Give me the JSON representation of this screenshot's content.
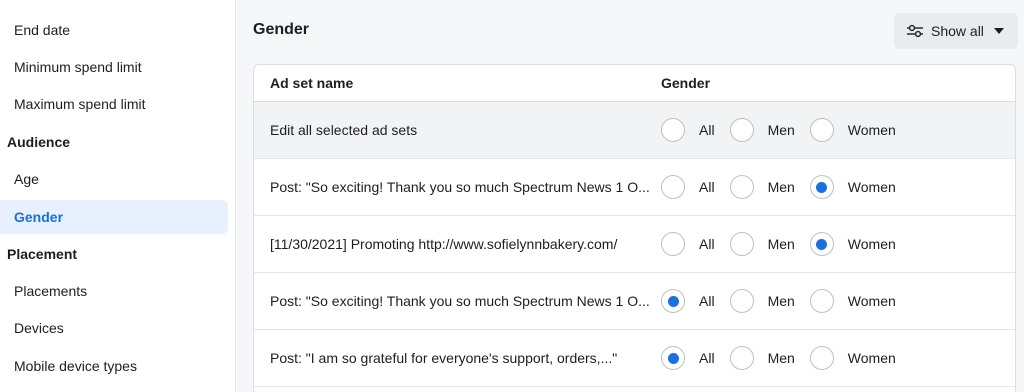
{
  "sidebar": {
    "items": [
      {
        "label": "End date",
        "type": "item"
      },
      {
        "label": "Minimum spend limit",
        "type": "item"
      },
      {
        "label": "Maximum spend limit",
        "type": "item"
      },
      {
        "label": "Audience",
        "type": "section"
      },
      {
        "label": "Age",
        "type": "item"
      },
      {
        "label": "Gender",
        "type": "item",
        "active": true
      },
      {
        "label": "Placement",
        "type": "section"
      },
      {
        "label": "Placements",
        "type": "item"
      },
      {
        "label": "Devices",
        "type": "item"
      },
      {
        "label": "Mobile device types",
        "type": "item"
      }
    ]
  },
  "main": {
    "title": "Gender",
    "show_all_label": "Show all"
  },
  "table": {
    "headers": {
      "name": "Ad set name",
      "gender": "Gender"
    },
    "options": [
      "All",
      "Men",
      "Women"
    ],
    "rows": [
      {
        "name": "Edit all selected ad sets",
        "selected": null
      },
      {
        "name": "Post: \"So exciting! Thank you so much Spectrum News 1 O...",
        "selected": "Women"
      },
      {
        "name": "[11/30/2021] Promoting http://www.sofielynnbakery.com/",
        "selected": "Women"
      },
      {
        "name": "Post: \"So exciting! Thank you so much Spectrum News 1 O...",
        "selected": "All"
      },
      {
        "name": "Post: \"I am so grateful for everyone's support, orders,...\"",
        "selected": "All"
      }
    ]
  },
  "colors": {
    "accent": "#1b6fe0",
    "active_bg": "#e7f0fd"
  }
}
